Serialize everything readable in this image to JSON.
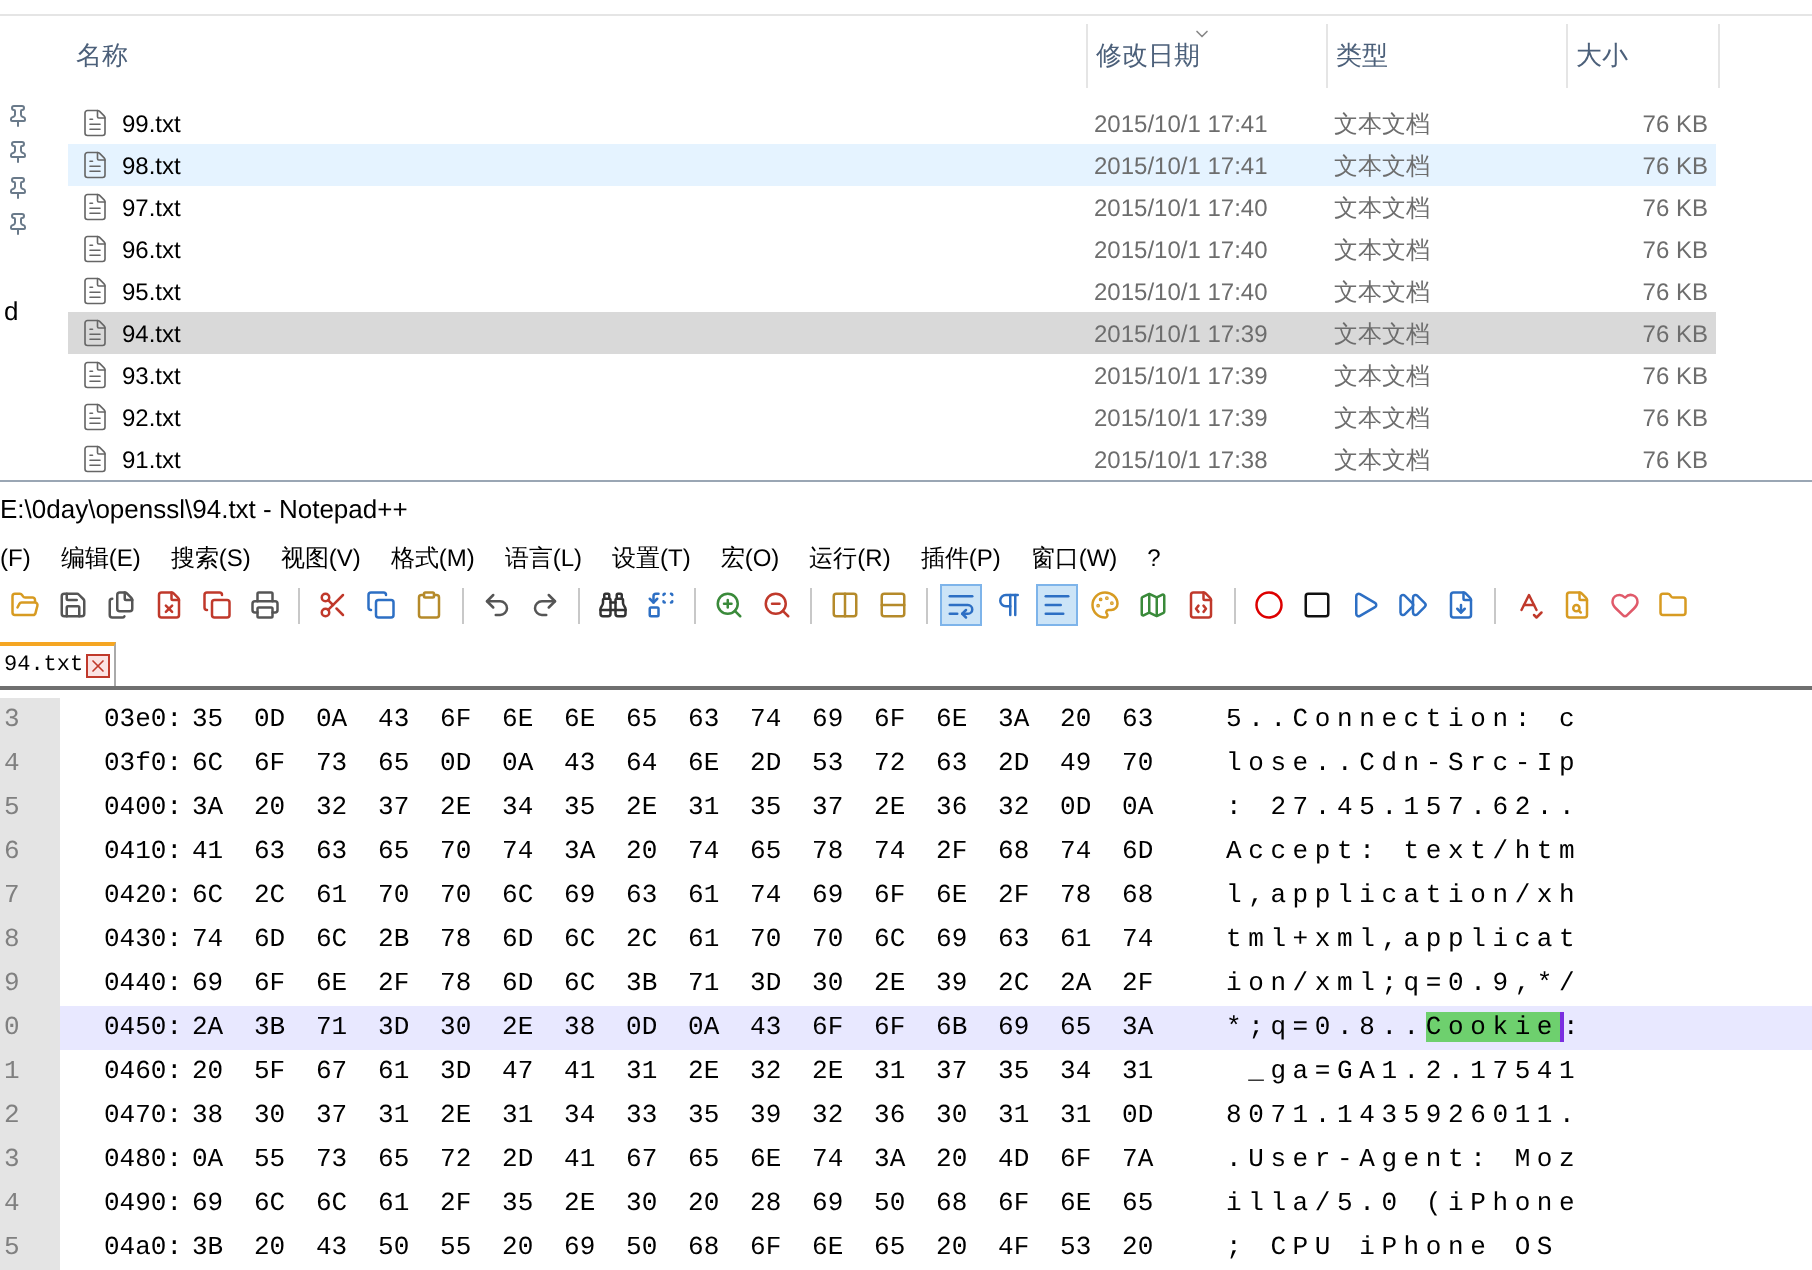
{
  "explorer": {
    "columns": [
      {
        "label": "名称",
        "sorted": false
      },
      {
        "label": "修改日期",
        "sorted": true
      },
      {
        "label": "类型",
        "sorted": false
      },
      {
        "label": "大小",
        "sorted": false
      }
    ],
    "nav_text": "d",
    "rows": [
      {
        "name": "99.txt",
        "date": "2015/10/1 17:41",
        "type": "文本文档",
        "size": "76 KB",
        "selected": false,
        "hovered": false
      },
      {
        "name": "98.txt",
        "date": "2015/10/1 17:41",
        "type": "文本文档",
        "size": "76 KB",
        "selected": false,
        "hovered": true
      },
      {
        "name": "97.txt",
        "date": "2015/10/1 17:40",
        "type": "文本文档",
        "size": "76 KB",
        "selected": false,
        "hovered": false
      },
      {
        "name": "96.txt",
        "date": "2015/10/1 17:40",
        "type": "文本文档",
        "size": "76 KB",
        "selected": false,
        "hovered": false
      },
      {
        "name": "95.txt",
        "date": "2015/10/1 17:40",
        "type": "文本文档",
        "size": "76 KB",
        "selected": false,
        "hovered": false
      },
      {
        "name": "94.txt",
        "date": "2015/10/1 17:39",
        "type": "文本文档",
        "size": "76 KB",
        "selected": true,
        "hovered": false
      },
      {
        "name": "93.txt",
        "date": "2015/10/1 17:39",
        "type": "文本文档",
        "size": "76 KB",
        "selected": false,
        "hovered": false
      },
      {
        "name": "92.txt",
        "date": "2015/10/1 17:39",
        "type": "文本文档",
        "size": "76 KB",
        "selected": false,
        "hovered": false
      },
      {
        "name": "91.txt",
        "date": "2015/10/1 17:38",
        "type": "文本文档",
        "size": "76 KB",
        "selected": false,
        "hovered": false
      }
    ]
  },
  "notepad": {
    "title": "E:\\0day\\openssl\\94.txt - Notepad++",
    "menu": [
      "(F)",
      "编辑(E)",
      "搜索(S)",
      "视图(V)",
      "格式(M)",
      "语言(L)",
      "设置(T)",
      "宏(O)",
      "运行(R)",
      "插件(P)",
      "窗口(W)",
      "?"
    ],
    "toolbar": [
      {
        "selected": false
      },
      {
        "selected": false
      },
      {
        "selected": false
      },
      {
        "selected": false
      },
      {
        "selected": false
      },
      {
        "selected": false
      },
      {
        "selected": false
      },
      {
        "selected": false
      },
      {
        "selected": false
      },
      {
        "selected": false
      },
      {
        "selected": false
      },
      {
        "selected": false
      },
      {
        "selected": false
      },
      {
        "selected": false
      },
      {
        "selected": false
      },
      {
        "selected": false
      },
      {
        "selected": false
      },
      {
        "selected": true
      },
      {
        "selected": false
      },
      {
        "selected": true
      },
      {
        "selected": false
      },
      {
        "selected": false
      },
      {
        "selected": false
      },
      {
        "selected": false
      },
      {
        "selected": false
      },
      {
        "selected": false
      },
      {
        "selected": false
      },
      {
        "selected": false
      },
      {
        "selected": false
      },
      {
        "selected": false
      },
      {
        "selected": false
      },
      {
        "selected": false
      }
    ],
    "tabs": [
      {
        "label": "94.txt",
        "selected": true
      }
    ],
    "lines": [
      {
        "num": "3",
        "offset": "03e0:",
        "hex": "35 0D 0A 43 6F 6E 6E 65 63 74 69 6F 6E 3A 20 63",
        "ascii": [
          {
            "text": "5..Connection: c",
            "match": false
          }
        ],
        "current": false
      },
      {
        "num": "4",
        "offset": "03f0:",
        "hex": "6C 6F 73 65 0D 0A 43 64 6E 2D 53 72 63 2D 49 70",
        "ascii": [
          {
            "text": "lose..Cdn-Src-Ip",
            "match": false
          }
        ],
        "current": false
      },
      {
        "num": "5",
        "offset": "0400:",
        "hex": "3A 20 32 37 2E 34 35 2E 31 35 37 2E 36 32 0D 0A",
        "ascii": [
          {
            "text": ": 27.45.157.62..",
            "match": false
          }
        ],
        "current": false
      },
      {
        "num": "6",
        "offset": "0410:",
        "hex": "41 63 63 65 70 74 3A 20 74 65 78 74 2F 68 74 6D",
        "ascii": [
          {
            "text": "Accept: text/htm",
            "match": false
          }
        ],
        "current": false
      },
      {
        "num": "7",
        "offset": "0420:",
        "hex": "6C 2C 61 70 70 6C 69 63 61 74 69 6F 6E 2F 78 68",
        "ascii": [
          {
            "text": "l,application/xh",
            "match": false
          }
        ],
        "current": false
      },
      {
        "num": "8",
        "offset": "0430:",
        "hex": "74 6D 6C 2B 78 6D 6C 2C 61 70 70 6C 69 63 61 74",
        "ascii": [
          {
            "text": "tml+xml,applicat",
            "match": false
          }
        ],
        "current": false
      },
      {
        "num": "9",
        "offset": "0440:",
        "hex": "69 6F 6E 2F 78 6D 6C 3B 71 3D 30 2E 39 2C 2A 2F",
        "ascii": [
          {
            "text": "ion/xml;q=0.9,*/",
            "match": false
          }
        ],
        "current": false
      },
      {
        "num": "0",
        "offset": "0450:",
        "hex": "2A 3B 71 3D 30 2E 38 0D 0A 43 6F 6F 6B 69 65 3A",
        "ascii": [
          {
            "text": "*;q=0.8..",
            "match": false
          },
          {
            "text": "Cookie",
            "match": true
          },
          {
            "text": ":",
            "match": false
          }
        ],
        "current": true
      },
      {
        "num": "1",
        "offset": "0460:",
        "hex": "20 5F 67 61 3D 47 41 31 2E 32 2E 31 37 35 34 31",
        "ascii": [
          {
            "text": " _ga=GA1.2.17541",
            "match": false
          }
        ],
        "current": false
      },
      {
        "num": "2",
        "offset": "0470:",
        "hex": "38 30 37 31 2E 31 34 33 35 39 32 36 30 31 31 0D",
        "ascii": [
          {
            "text": "8071.1435926011.",
            "match": false
          }
        ],
        "current": false
      },
      {
        "num": "3",
        "offset": "0480:",
        "hex": "0A 55 73 65 72 2D 41 67 65 6E 74 3A 20 4D 6F 7A",
        "ascii": [
          {
            "text": ".User-Agent: Moz",
            "match": false
          }
        ],
        "current": false
      },
      {
        "num": "4",
        "offset": "0490:",
        "hex": "69 6C 6C 61 2F 35 2E 30 20 28 69 50 68 6F 6E 65",
        "ascii": [
          {
            "text": "illa/5.0 (iPhone",
            "match": false
          }
        ],
        "current": false
      },
      {
        "num": "5",
        "offset": "04a0:",
        "hex": "3B 20 43 50 55 20 69 50 68 6F 6E 65 20 4F 53 20",
        "ascii": [
          {
            "text": "; CPU iPhone OS",
            "match": false
          }
        ],
        "current": false
      }
    ]
  }
}
